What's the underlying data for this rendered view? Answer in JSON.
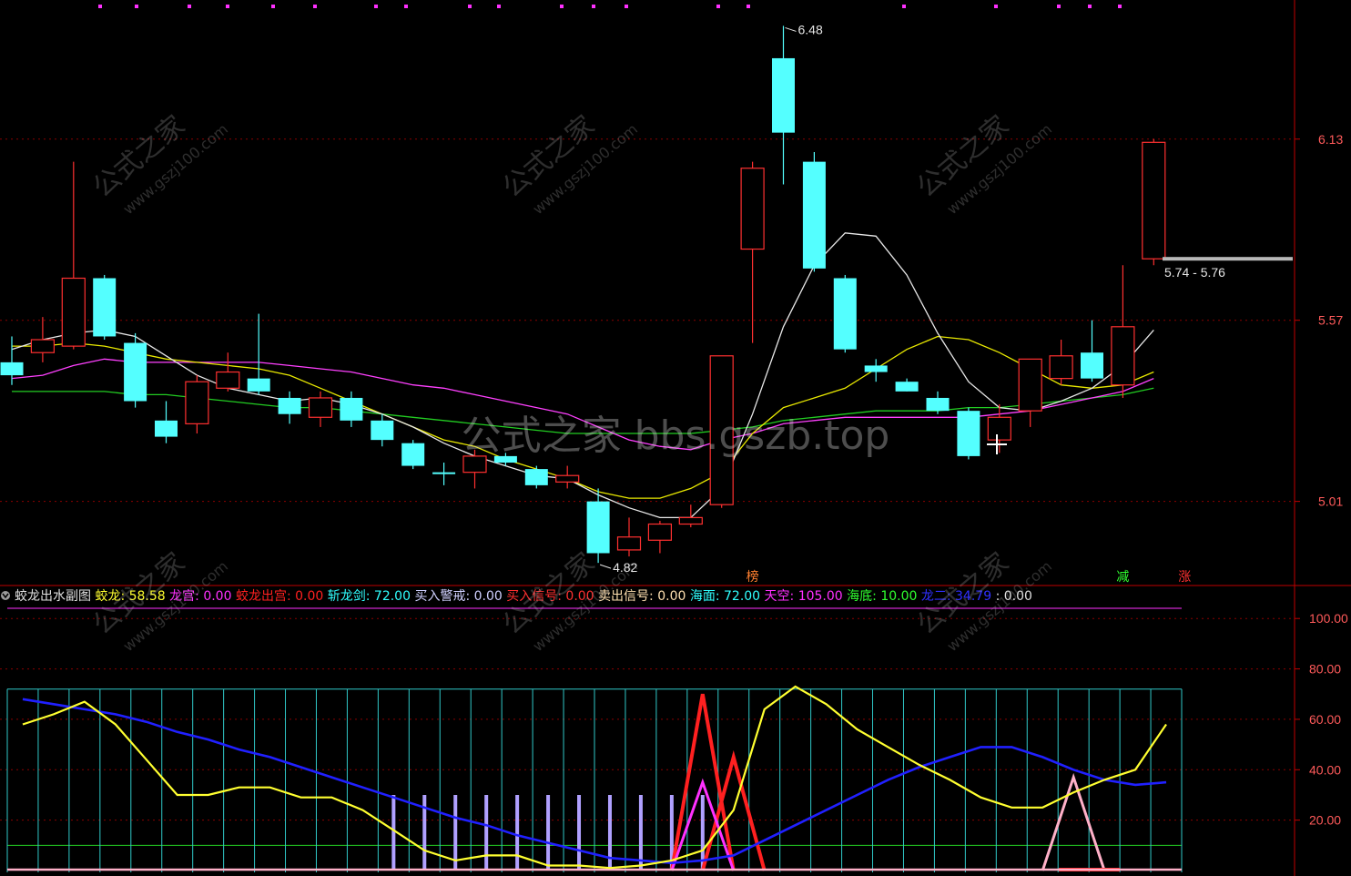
{
  "colors": {
    "up": "#ff3030",
    "down": "#54ffff",
    "ma5": "#e8e8e8",
    "ma10": "#e8e800",
    "ma20": "#ff40ff",
    "ma60": "#22cc22",
    "axis": "#c00000",
    "grid": "#8a0000",
    "panel_grid": "#30c8c8",
    "jiaolong": "#ffff30",
    "longgong": "#2020ff",
    "alert": "#b0a0ff",
    "sell": "#ff2020",
    "chuGong": "#ff30ff",
    "pink": "#ffb0c8"
  },
  "watermark": {
    "center": "公式之家 bbs.gszb.top",
    "tile_cn": "公式之家",
    "tile_url": "www.gszj100.com"
  },
  "chart_data": [
    {
      "type": "candlestick",
      "title": "",
      "ylim": [
        4.75,
        6.56
      ],
      "ytick_labels": [
        "6.13",
        "5.57",
        "5.01"
      ],
      "ytick_values": [
        6.13,
        5.57,
        5.01
      ],
      "candles": [
        {
          "o": 5.4,
          "h": 5.52,
          "l": 5.37,
          "c": 5.44,
          "dir": "down"
        },
        {
          "o": 5.47,
          "h": 5.58,
          "l": 5.44,
          "c": 5.51,
          "dir": "up"
        },
        {
          "o": 5.49,
          "h": 6.06,
          "l": 5.48,
          "c": 5.7,
          "dir": "up"
        },
        {
          "o": 5.7,
          "h": 5.71,
          "l": 5.51,
          "c": 5.52,
          "dir": "down"
        },
        {
          "o": 5.5,
          "h": 5.53,
          "l": 5.3,
          "c": 5.32,
          "dir": "down"
        },
        {
          "o": 5.26,
          "h": 5.32,
          "l": 5.19,
          "c": 5.21,
          "dir": "down"
        },
        {
          "o": 5.25,
          "h": 5.4,
          "l": 5.22,
          "c": 5.38,
          "dir": "up"
        },
        {
          "o": 5.36,
          "h": 5.47,
          "l": 5.35,
          "c": 5.41,
          "dir": "up"
        },
        {
          "o": 5.39,
          "h": 5.59,
          "l": 5.34,
          "c": 5.35,
          "dir": "down"
        },
        {
          "o": 5.33,
          "h": 5.35,
          "l": 5.25,
          "c": 5.28,
          "dir": "down"
        },
        {
          "o": 5.27,
          "h": 5.35,
          "l": 5.24,
          "c": 5.33,
          "dir": "up"
        },
        {
          "o": 5.33,
          "h": 5.35,
          "l": 5.24,
          "c": 5.26,
          "dir": "down"
        },
        {
          "o": 5.26,
          "h": 5.28,
          "l": 5.18,
          "c": 5.2,
          "dir": "down"
        },
        {
          "o": 5.19,
          "h": 5.2,
          "l": 5.11,
          "c": 5.12,
          "dir": "down"
        },
        {
          "o": 5.1,
          "h": 5.13,
          "l": 5.06,
          "c": 5.1,
          "dir": "down"
        },
        {
          "o": 5.1,
          "h": 5.17,
          "l": 5.05,
          "c": 5.15,
          "dir": "up"
        },
        {
          "o": 5.15,
          "h": 5.16,
          "l": 5.12,
          "c": 5.13,
          "dir": "down"
        },
        {
          "o": 5.11,
          "h": 5.12,
          "l": 5.05,
          "c": 5.06,
          "dir": "down"
        },
        {
          "o": 5.07,
          "h": 5.12,
          "l": 5.05,
          "c": 5.09,
          "dir": "up"
        },
        {
          "o": 5.01,
          "h": 5.05,
          "l": 4.82,
          "c": 4.85,
          "dir": "down"
        },
        {
          "o": 4.86,
          "h": 4.96,
          "l": 4.84,
          "c": 4.9,
          "dir": "up"
        },
        {
          "o": 4.89,
          "h": 4.95,
          "l": 4.85,
          "c": 4.94,
          "dir": "up"
        },
        {
          "o": 4.94,
          "h": 5.0,
          "l": 4.93,
          "c": 4.96,
          "dir": "up"
        },
        {
          "o": 5.0,
          "h": 5.46,
          "l": 4.99,
          "c": 5.46,
          "dir": "up"
        },
        {
          "o": 5.79,
          "h": 6.06,
          "l": 5.5,
          "c": 6.04,
          "dir": "up"
        },
        {
          "o": 6.38,
          "h": 6.48,
          "l": 5.99,
          "c": 6.15,
          "dir": "down"
        },
        {
          "o": 6.06,
          "h": 6.09,
          "l": 5.72,
          "c": 5.73,
          "dir": "down"
        },
        {
          "o": 5.7,
          "h": 5.71,
          "l": 5.47,
          "c": 5.48,
          "dir": "down"
        },
        {
          "o": 5.43,
          "h": 5.45,
          "l": 5.38,
          "c": 5.41,
          "dir": "down"
        },
        {
          "o": 5.38,
          "h": 5.39,
          "l": 5.35,
          "c": 5.35,
          "dir": "down"
        },
        {
          "o": 5.33,
          "h": 5.35,
          "l": 5.28,
          "c": 5.29,
          "dir": "down"
        },
        {
          "o": 5.29,
          "h": 5.3,
          "l": 5.14,
          "c": 5.15,
          "dir": "down"
        },
        {
          "o": 5.2,
          "h": 5.31,
          "l": 5.16,
          "c": 5.27,
          "dir": "up"
        },
        {
          "o": 5.29,
          "h": 5.45,
          "l": 5.24,
          "c": 5.45,
          "dir": "up"
        },
        {
          "o": 5.39,
          "h": 5.51,
          "l": 5.37,
          "c": 5.46,
          "dir": "up"
        },
        {
          "o": 5.47,
          "h": 5.57,
          "l": 5.38,
          "c": 5.39,
          "dir": "down"
        },
        {
          "o": 5.37,
          "h": 5.74,
          "l": 5.33,
          "c": 5.55,
          "dir": "up"
        },
        {
          "o": 5.76,
          "h": 6.13,
          "l": 5.74,
          "c": 6.12,
          "dir": "up"
        }
      ],
      "ma5": [
        5.48,
        5.51,
        5.53,
        5.54,
        5.52,
        5.46,
        5.4,
        5.36,
        5.34,
        5.32,
        5.33,
        5.31,
        5.28,
        5.24,
        5.19,
        5.15,
        5.12,
        5.09,
        5.08,
        5.03,
        4.99,
        4.96,
        4.96,
        5.05,
        5.28,
        5.55,
        5.74,
        5.84,
        5.83,
        5.71,
        5.53,
        5.38,
        5.3,
        5.29,
        5.32,
        5.36,
        5.43,
        5.54
      ],
      "ma10": [
        5.49,
        5.49,
        5.5,
        5.49,
        5.47,
        5.45,
        5.44,
        5.43,
        5.42,
        5.4,
        5.36,
        5.32,
        5.28,
        5.24,
        5.2,
        5.18,
        5.14,
        5.11,
        5.08,
        5.04,
        5.02,
        5.02,
        5.05,
        5.1,
        5.22,
        5.3,
        5.33,
        5.36,
        5.42,
        5.48,
        5.52,
        5.51,
        5.47,
        5.42,
        5.37,
        5.36,
        5.37,
        5.41
      ],
      "ma20": [
        5.39,
        5.4,
        5.43,
        5.45,
        5.44,
        5.44,
        5.44,
        5.44,
        5.44,
        5.43,
        5.42,
        5.41,
        5.39,
        5.37,
        5.36,
        5.34,
        5.32,
        5.3,
        5.28,
        5.24,
        5.2,
        5.18,
        5.17,
        5.2,
        5.22,
        5.25,
        5.26,
        5.27,
        5.27,
        5.27,
        5.27,
        5.27,
        5.28,
        5.29,
        5.31,
        5.33,
        5.35,
        5.39
      ],
      "ma60": [
        5.35,
        5.35,
        5.35,
        5.35,
        5.34,
        5.34,
        5.33,
        5.32,
        5.31,
        5.3,
        5.3,
        5.29,
        5.28,
        5.27,
        5.26,
        5.25,
        5.24,
        5.23,
        5.22,
        5.22,
        5.22,
        5.22,
        5.22,
        5.23,
        5.24,
        5.26,
        5.27,
        5.28,
        5.29,
        5.29,
        5.29,
        5.3,
        5.3,
        5.31,
        5.32,
        5.33,
        5.34,
        5.36
      ],
      "annotations": {
        "high": "6.48",
        "low": "4.82",
        "range_label": "5.74 - 5.76"
      },
      "signal_labels": [
        {
          "index": 24,
          "text": "榜",
          "color": "#ff8030"
        },
        {
          "index": 36,
          "text": "减",
          "color": "#30ff30"
        },
        {
          "index": 38,
          "text": "涨",
          "color": "#ff3030"
        }
      ]
    },
    {
      "type": "line",
      "title": "蛟龙出水副图",
      "ylim": [
        0,
        112
      ],
      "ytick_labels": [
        "100.00",
        "80.00",
        "60.00",
        "40.00",
        "20.00"
      ],
      "ytick_values": [
        100,
        80,
        60,
        40,
        20
      ],
      "legend": [
        {
          "label": "蛟龙",
          "value": "58.58",
          "color": "#ffff30"
        },
        {
          "label": "龙宫",
          "value": "0.00",
          "color": "#ff30ff"
        },
        {
          "label": "蛟龙出宫",
          "value": "0.00",
          "color": "#ff2020"
        },
        {
          "label": "斩龙剑",
          "value": "72.00",
          "color": "#30ffff"
        },
        {
          "label": "买入警戒",
          "value": "0.00",
          "color": "#d0d0ff"
        },
        {
          "label": "买入信号",
          "value": "0.00",
          "color": "#ff3030"
        },
        {
          "label": "卖出信号",
          "value": "0.00",
          "color": "#ffe0b0"
        },
        {
          "label": "海面",
          "value": "72.00",
          "color": "#30ffff"
        },
        {
          "label": "天空",
          "value": "105.00",
          "color": "#ff30ff"
        },
        {
          "label": "海底",
          "value": "10.00",
          "color": "#30ff30"
        },
        {
          "label": "龙二",
          "value": "34.79",
          "color": "#3030ff"
        },
        {
          "label": "",
          "value": "0.00",
          "color": "#e0e0e0"
        }
      ],
      "levels": {
        "sky": 105,
        "sea": 72,
        "seabed": 10
      },
      "series": [
        {
          "name": "蛟龙",
          "values": [
            58,
            62,
            67,
            58,
            44,
            30,
            30,
            33,
            33,
            29,
            29,
            24,
            16,
            8,
            4,
            6,
            6,
            2,
            2,
            1,
            2,
            4,
            8,
            24,
            64,
            73,
            66,
            56,
            49,
            42,
            36,
            29,
            25,
            25,
            31,
            36,
            40,
            58
          ]
        },
        {
          "name": "龙二",
          "values": [
            68,
            66,
            64,
            62,
            59,
            55,
            52,
            48,
            45,
            41,
            37,
            33,
            29,
            25,
            21,
            18,
            14,
            11,
            8,
            5,
            4,
            3,
            4,
            6,
            12,
            18,
            24,
            30,
            36,
            41,
            45,
            49,
            49,
            45,
            40,
            36,
            34,
            35
          ]
        },
        {
          "name": "买入警戒",
          "values": [
            0,
            0,
            0,
            0,
            0,
            0,
            0,
            0,
            0,
            0,
            0,
            0,
            30,
            30,
            30,
            30,
            30,
            30,
            30,
            30,
            30,
            30,
            30,
            0,
            0,
            0,
            0,
            0,
            0,
            0,
            0,
            0,
            0,
            0,
            0,
            0,
            0,
            0
          ]
        },
        {
          "name": "卖出",
          "values": [
            0,
            0,
            0,
            0,
            0,
            0,
            0,
            0,
            0,
            0,
            0,
            0,
            0,
            0,
            0,
            0,
            0,
            0,
            0,
            0,
            0,
            0,
            70,
            45,
            0,
            0,
            0,
            0,
            0,
            0,
            0,
            0,
            0,
            0,
            0,
            0,
            0,
            0
          ]
        },
        {
          "name": "龙宫",
          "values": [
            0,
            0,
            0,
            0,
            0,
            0,
            0,
            0,
            0,
            0,
            0,
            0,
            0,
            0,
            0,
            0,
            0,
            0,
            0,
            0,
            0,
            0,
            35,
            0,
            0,
            0,
            0,
            0,
            0,
            0,
            0,
            0,
            0,
            0,
            0,
            0,
            0,
            0
          ]
        },
        {
          "name": "粉",
          "values": [
            0,
            0,
            0,
            0,
            0,
            0,
            0,
            0,
            0,
            0,
            0,
            0,
            0,
            0,
            0,
            0,
            0,
            0,
            0,
            0,
            0,
            0,
            0,
            0,
            0,
            0,
            0,
            0,
            0,
            0,
            0,
            0,
            0,
            0,
            37,
            0,
            0,
            0
          ]
        }
      ]
    }
  ]
}
